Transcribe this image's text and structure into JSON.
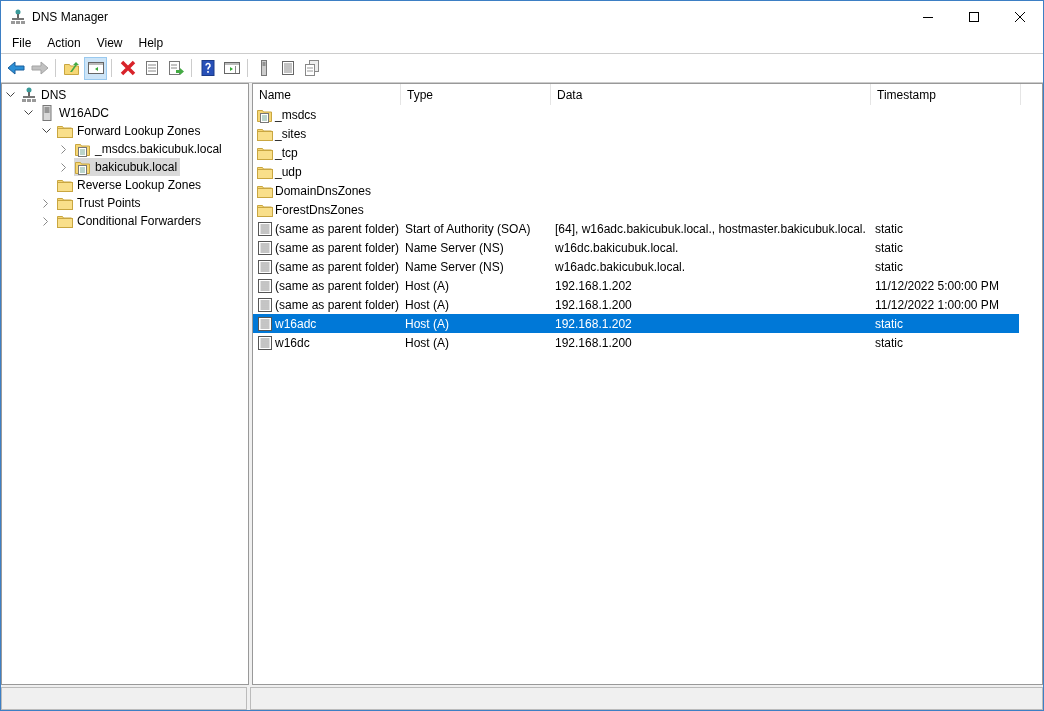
{
  "window": {
    "title": "DNS Manager"
  },
  "menu": [
    "File",
    "Action",
    "View",
    "Help"
  ],
  "toolbar": [
    {
      "kind": "back",
      "disabled": false
    },
    {
      "kind": "forward",
      "disabled": true
    },
    {
      "kind": "separator"
    },
    {
      "kind": "up-folder",
      "disabled": false
    },
    {
      "kind": "console-tree",
      "pressed": true,
      "disabled": false
    },
    {
      "kind": "separator"
    },
    {
      "kind": "delete",
      "disabled": false
    },
    {
      "kind": "properties",
      "disabled": false
    },
    {
      "kind": "export",
      "disabled": false
    },
    {
      "kind": "separator"
    },
    {
      "kind": "help",
      "disabled": false
    },
    {
      "kind": "action-pane",
      "disabled": false
    },
    {
      "kind": "separator"
    },
    {
      "kind": "server",
      "disabled": false
    },
    {
      "kind": "record-list",
      "disabled": false
    },
    {
      "kind": "copy",
      "disabled": false
    }
  ],
  "tree": [
    {
      "label": "DNS",
      "kind": "dns",
      "expanded": true,
      "selected": false,
      "children": [
        {
          "label": "W16ADC",
          "kind": "server",
          "expanded": true,
          "selected": false,
          "children": [
            {
              "label": "Forward Lookup Zones",
              "kind": "folder",
              "expanded": true,
              "selected": false,
              "children": [
                {
                  "label": "_msdcs.bakicubuk.local",
                  "kind": "zone",
                  "expanded": false,
                  "selected": false
                },
                {
                  "label": "bakicubuk.local",
                  "kind": "zone",
                  "expanded": false,
                  "selected": true
                }
              ]
            },
            {
              "label": "Reverse Lookup Zones",
              "kind": "folder",
              "selected": false
            },
            {
              "label": "Trust Points",
              "kind": "folder",
              "expanded": false,
              "selected": false
            },
            {
              "label": "Conditional Forwarders",
              "kind": "folder",
              "expanded": false,
              "selected": false
            }
          ]
        }
      ]
    }
  ],
  "table": {
    "columns": [
      "Name",
      "Type",
      "Data",
      "Timestamp"
    ],
    "rows": [
      {
        "kind": "zone",
        "selected": false,
        "cells": [
          "_msdcs",
          "",
          "",
          ""
        ]
      },
      {
        "kind": "folder",
        "selected": false,
        "cells": [
          "_sites",
          "",
          "",
          ""
        ]
      },
      {
        "kind": "folder",
        "selected": false,
        "cells": [
          "_tcp",
          "",
          "",
          ""
        ]
      },
      {
        "kind": "folder",
        "selected": false,
        "cells": [
          "_udp",
          "",
          "",
          ""
        ]
      },
      {
        "kind": "folder",
        "selected": false,
        "cells": [
          "DomainDnsZones",
          "",
          "",
          ""
        ]
      },
      {
        "kind": "folder",
        "selected": false,
        "cells": [
          "ForestDnsZones",
          "",
          "",
          ""
        ]
      },
      {
        "kind": "record",
        "selected": false,
        "cells": [
          "(same as parent folder)",
          "Start of Authority (SOA)",
          "[64], w16adc.bakicubuk.local., hostmaster.bakicubuk.local.",
          "static"
        ]
      },
      {
        "kind": "record",
        "selected": false,
        "cells": [
          "(same as parent folder)",
          "Name Server (NS)",
          "w16dc.bakicubuk.local.",
          "static"
        ]
      },
      {
        "kind": "record",
        "selected": false,
        "cells": [
          "(same as parent folder)",
          "Name Server (NS)",
          "w16adc.bakicubuk.local.",
          "static"
        ]
      },
      {
        "kind": "record",
        "selected": false,
        "cells": [
          "(same as parent folder)",
          "Host (A)",
          "192.168.1.202",
          "11/12/2022 5:00:00 PM"
        ]
      },
      {
        "kind": "record",
        "selected": false,
        "cells": [
          "(same as parent folder)",
          "Host (A)",
          "192.168.1.200",
          "11/12/2022 1:00:00 PM"
        ]
      },
      {
        "kind": "record",
        "selected": true,
        "cells": [
          "w16adc",
          "Host (A)",
          "192.168.1.202",
          "static"
        ]
      },
      {
        "kind": "record",
        "selected": false,
        "cells": [
          "w16dc",
          "Host (A)",
          "192.168.1.200",
          "static"
        ]
      }
    ]
  }
}
